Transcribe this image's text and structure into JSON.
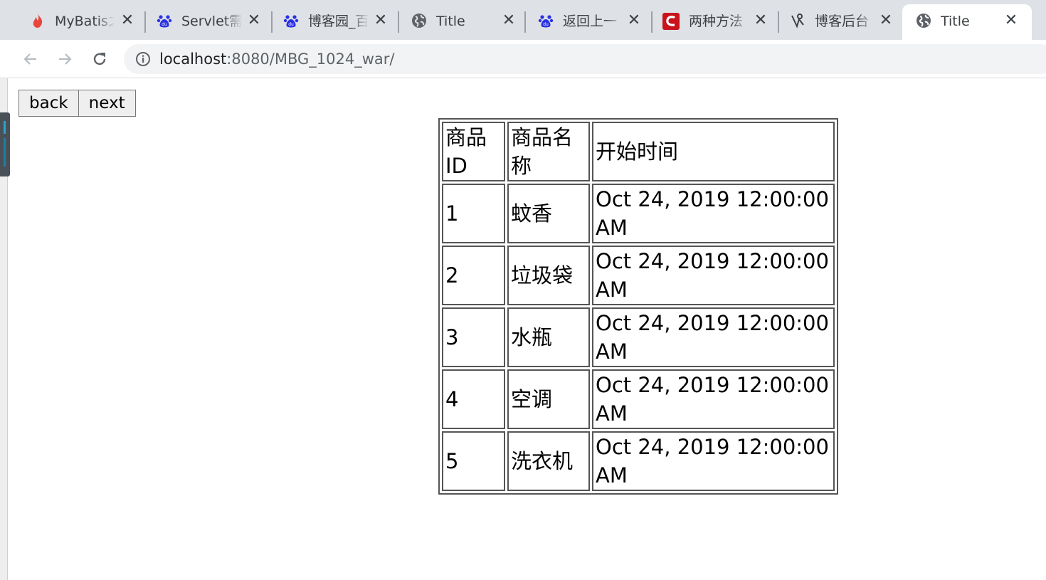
{
  "tabs": [
    {
      "title": "MyBatis之",
      "icon": "flame-icon"
    },
    {
      "title": "Servlet需",
      "icon": "baidu-paw-icon"
    },
    {
      "title": "博客园_百",
      "icon": "baidu-paw-icon"
    },
    {
      "title": "Title",
      "icon": "globe-icon"
    },
    {
      "title": "返回上一",
      "icon": "baidu-paw-icon"
    },
    {
      "title": "两种方法",
      "icon": "csdn-icon"
    },
    {
      "title": "博客后台",
      "icon": "cnblogs-icon"
    },
    {
      "title": "Title",
      "icon": "globe-icon",
      "active": true
    }
  ],
  "toolbar": {
    "url_host": "localhost",
    "url_rest": ":8080/MBG_1024_war/"
  },
  "page": {
    "back_label": "back",
    "next_label": "next"
  },
  "table": {
    "headers": [
      "商品ID",
      "商品名称",
      "开始时间"
    ],
    "rows": [
      [
        "1",
        "蚊香",
        "Oct 24, 2019 12:00:00 AM"
      ],
      [
        "2",
        "垃圾袋",
        "Oct 24, 2019 12:00:00 AM"
      ],
      [
        "3",
        "水瓶",
        "Oct 24, 2019 12:00:00 AM"
      ],
      [
        "4",
        "空调",
        "Oct 24, 2019 12:00:00 AM"
      ],
      [
        "5",
        "洗衣机",
        "Oct 24, 2019 12:00:00 AM"
      ]
    ]
  },
  "colors": {
    "tabstrip": "#dee1e6",
    "flame": "#e8453c",
    "baidu": "#2932e1",
    "csdn": "#c9131b"
  }
}
